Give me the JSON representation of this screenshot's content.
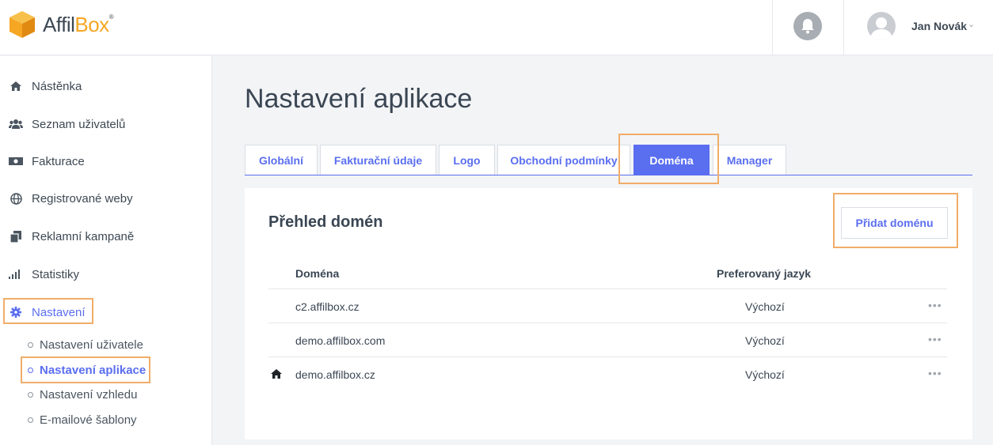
{
  "header": {
    "logo": {
      "part1": "Affil",
      "part2": "Box",
      "reg": "®"
    },
    "user": {
      "name": "Jan Novák"
    }
  },
  "sidebar": {
    "items": [
      {
        "label": "Nástěnka",
        "icon": "home-icon"
      },
      {
        "label": "Seznam uživatelů",
        "icon": "users-icon"
      },
      {
        "label": "Fakturace",
        "icon": "money-icon"
      },
      {
        "label": "Registrované weby",
        "icon": "globe-icon"
      },
      {
        "label": "Reklamní kampaně",
        "icon": "copy-icon"
      },
      {
        "label": "Statistiky",
        "icon": "signal-icon"
      },
      {
        "label": "Nastavení",
        "icon": "gear-icon",
        "active": true
      }
    ],
    "subitems": [
      {
        "label": "Nastavení uživatele"
      },
      {
        "label": "Nastavení aplikace",
        "active": true
      },
      {
        "label": "Nastavení vzhledu"
      },
      {
        "label": "E-mailové šablony"
      }
    ]
  },
  "main": {
    "title": "Nastavení aplikace",
    "tabs": [
      {
        "label": "Globální"
      },
      {
        "label": "Fakturační údaje"
      },
      {
        "label": "Logo"
      },
      {
        "label": "Obchodní podmínky"
      },
      {
        "label": "Doména",
        "active": true
      },
      {
        "label": "Manager"
      }
    ],
    "card": {
      "title": "Přehled domén",
      "add_button": "Přidat doménu",
      "columns": {
        "domain": "Doména",
        "language": "Preferovaný jazyk"
      },
      "rows": [
        {
          "domain": "c2.affilbox.cz",
          "language": "Výchozí",
          "home": false
        },
        {
          "domain": "demo.affilbox.com",
          "language": "Výchozí",
          "home": false
        },
        {
          "domain": "demo.affilbox.cz",
          "language": "Výchozí",
          "home": true
        }
      ],
      "row_menu": "•••"
    }
  },
  "colors": {
    "accent": "#5a6ef0",
    "highlight": "#f0ad69",
    "logo_orange": "#f5a623"
  }
}
